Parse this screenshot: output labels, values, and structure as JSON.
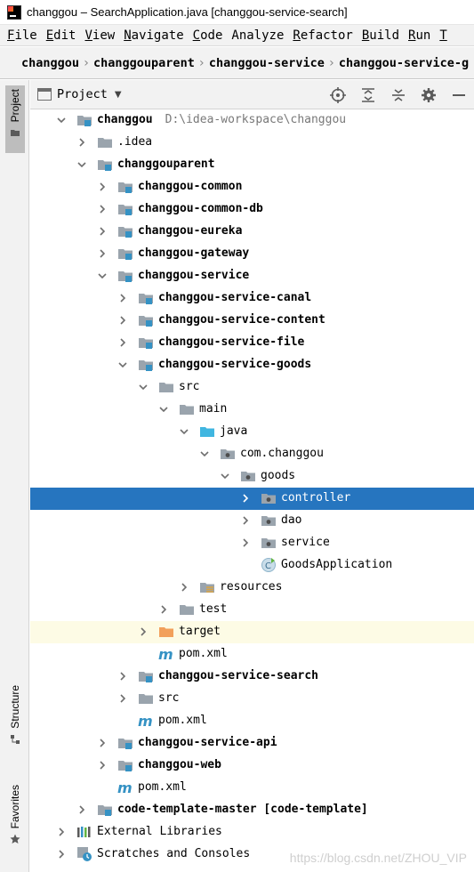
{
  "window": {
    "title": "changgou – SearchApplication.java [changgou-service-search]"
  },
  "menu": [
    {
      "mnemonic": "F",
      "rest": "ile"
    },
    {
      "mnemonic": "E",
      "rest": "dit"
    },
    {
      "mnemonic": "V",
      "rest": "iew"
    },
    {
      "mnemonic": "N",
      "rest": "avigate"
    },
    {
      "mnemonic": "C",
      "rest": "ode"
    },
    {
      "mnemonic": "",
      "rest": "Analyze"
    },
    {
      "mnemonic": "R",
      "rest": "efactor"
    },
    {
      "mnemonic": "B",
      "rest": "uild"
    },
    {
      "mnemonic": "R",
      "rest": "un"
    },
    {
      "mnemonic": "T",
      "rest": ""
    }
  ],
  "breadcrumb": [
    "changgou",
    "changgouparent",
    "changgou-service",
    "changgou-service-g"
  ],
  "left_strip": {
    "project": "Project",
    "structure": "Structure",
    "favorites": "Favorites"
  },
  "project_panel": {
    "title": "Project",
    "tools": [
      "locate-icon",
      "expand-all-icon",
      "collapse-all-icon",
      "gear-icon",
      "minimize-icon"
    ]
  },
  "tree": [
    {
      "depth": 0,
      "arrow": "down",
      "icon": "module",
      "label": "changgou",
      "path": "D:\\idea-workspace\\changgou",
      "bold": true
    },
    {
      "depth": 1,
      "arrow": "right",
      "icon": "folder",
      "label": ".idea"
    },
    {
      "depth": 1,
      "arrow": "down",
      "icon": "module",
      "label": "changgouparent",
      "bold": true
    },
    {
      "depth": 2,
      "arrow": "right",
      "icon": "module",
      "label": "changgou-common",
      "bold": true
    },
    {
      "depth": 2,
      "arrow": "right",
      "icon": "module",
      "label": "changgou-common-db",
      "bold": true
    },
    {
      "depth": 2,
      "arrow": "right",
      "icon": "module",
      "label": "changgou-eureka",
      "bold": true
    },
    {
      "depth": 2,
      "arrow": "right",
      "icon": "module",
      "label": "changgou-gateway",
      "bold": true
    },
    {
      "depth": 2,
      "arrow": "down",
      "icon": "module",
      "label": "changgou-service",
      "bold": true
    },
    {
      "depth": 3,
      "arrow": "right",
      "icon": "module",
      "label": "changgou-service-canal",
      "bold": true
    },
    {
      "depth": 3,
      "arrow": "right",
      "icon": "module",
      "label": "changgou-service-content",
      "bold": true
    },
    {
      "depth": 3,
      "arrow": "right",
      "icon": "module",
      "label": "changgou-service-file",
      "bold": true
    },
    {
      "depth": 3,
      "arrow": "down",
      "icon": "module",
      "label": "changgou-service-goods",
      "bold": true
    },
    {
      "depth": 4,
      "arrow": "down",
      "icon": "folder",
      "label": "src"
    },
    {
      "depth": 5,
      "arrow": "down",
      "icon": "folder",
      "label": "main"
    },
    {
      "depth": 6,
      "arrow": "down",
      "icon": "source-folder",
      "label": "java"
    },
    {
      "depth": 7,
      "arrow": "down",
      "icon": "package",
      "label": "com.changgou"
    },
    {
      "depth": 8,
      "arrow": "down",
      "icon": "package",
      "label": "goods"
    },
    {
      "depth": 9,
      "arrow": "right",
      "icon": "package",
      "label": "controller",
      "selected": true
    },
    {
      "depth": 9,
      "arrow": "right",
      "icon": "package",
      "label": "dao"
    },
    {
      "depth": 9,
      "arrow": "right",
      "icon": "package",
      "label": "service"
    },
    {
      "depth": 9,
      "arrow": "none",
      "icon": "spring-class",
      "label": "GoodsApplication"
    },
    {
      "depth": 6,
      "arrow": "right",
      "icon": "resources",
      "label": "resources"
    },
    {
      "depth": 5,
      "arrow": "right",
      "icon": "folder",
      "label": "test"
    },
    {
      "depth": 4,
      "arrow": "right",
      "icon": "excluded-folder",
      "label": "target",
      "excluded": true
    },
    {
      "depth": 4,
      "arrow": "none",
      "icon": "maven",
      "label": "pom.xml"
    },
    {
      "depth": 3,
      "arrow": "right",
      "icon": "module",
      "label": "changgou-service-search",
      "bold": true
    },
    {
      "depth": 3,
      "arrow": "right",
      "icon": "folder",
      "label": "src"
    },
    {
      "depth": 3,
      "arrow": "none",
      "icon": "maven",
      "label": "pom.xml"
    },
    {
      "depth": 2,
      "arrow": "right",
      "icon": "module",
      "label": "changgou-service-api",
      "bold": true
    },
    {
      "depth": 2,
      "arrow": "right",
      "icon": "module",
      "label": "changgou-web",
      "bold": true
    },
    {
      "depth": 2,
      "arrow": "none",
      "icon": "maven",
      "label": "pom.xml"
    },
    {
      "depth": 1,
      "arrow": "right",
      "icon": "module",
      "label": "code-template-master [code-template]",
      "bold": true
    },
    {
      "depth": 0,
      "arrow": "right",
      "icon": "libraries",
      "label": "External Libraries"
    },
    {
      "depth": 0,
      "arrow": "right",
      "icon": "scratches",
      "label": "Scratches and Consoles"
    }
  ],
  "watermark": "https://blog.csdn.net/ZHOU_VIP",
  "colors": {
    "selection": "#2675bf",
    "excluded_bg": "#fdfbe5",
    "module_badge": "#3592c4",
    "excluded_folder": "#f2a05b",
    "maven": "#3592c4"
  }
}
